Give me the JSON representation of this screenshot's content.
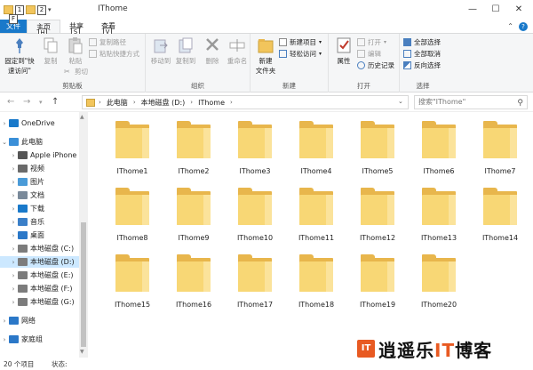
{
  "window": {
    "title": "IThome"
  },
  "quick_access": {
    "keytips": [
      "1",
      "2"
    ]
  },
  "tabs": [
    {
      "label": "文件",
      "keytip": "F"
    },
    {
      "label": "主页",
      "keytip": "H"
    },
    {
      "label": "共享",
      "keytip": "S"
    },
    {
      "label": "查看",
      "keytip": "V"
    }
  ],
  "ribbon": {
    "clipboard": {
      "group": "剪贴板",
      "pin_l1": "固定到\"快",
      "pin_l2": "速访问\"",
      "copy": "复制",
      "paste": "粘贴",
      "copy_path": "复制路径",
      "paste_shortcut": "粘贴快捷方式",
      "cut": "剪切"
    },
    "organize": {
      "group": "组织",
      "move_to": "移动到",
      "copy_to": "复制到",
      "delete": "删除",
      "rename": "重命名"
    },
    "new": {
      "group": "新建",
      "new_folder_l1": "新建",
      "new_folder_l2": "文件夹",
      "new_item": "新建项目",
      "easy_access": "轻松访问"
    },
    "open": {
      "group": "打开",
      "properties": "属性",
      "open": "打开",
      "edit": "编辑",
      "history": "历史记录"
    },
    "select": {
      "group": "选择",
      "select_all": "全部选择",
      "select_none": "全部取消",
      "invert": "反向选择"
    }
  },
  "address": {
    "crumbs": [
      "此电脑",
      "本地磁盘 (D:)",
      "IThome"
    ],
    "search_placeholder": "搜索\"IThome\""
  },
  "nav": {
    "items": [
      {
        "label": "OneDrive",
        "icon": "onedrive-icon"
      },
      {
        "label": "此电脑",
        "icon": "pc-icon"
      },
      {
        "label": "Apple iPhone",
        "icon": "phone-icon"
      },
      {
        "label": "视频",
        "icon": "video-icon"
      },
      {
        "label": "图片",
        "icon": "picture-icon"
      },
      {
        "label": "文档",
        "icon": "document-icon"
      },
      {
        "label": "下载",
        "icon": "download-icon"
      },
      {
        "label": "音乐",
        "icon": "music-icon"
      },
      {
        "label": "桌面",
        "icon": "desktop-icon"
      },
      {
        "label": "本地磁盘 (C:)",
        "icon": "drive-icon"
      },
      {
        "label": "本地磁盘 (D:)",
        "icon": "drive-icon"
      },
      {
        "label": "本地磁盘 (E:)",
        "icon": "drive-icon"
      },
      {
        "label": "本地磁盘 (F:)",
        "icon": "drive-icon"
      },
      {
        "label": "本地磁盘 (G:)",
        "icon": "drive-icon"
      },
      {
        "label": "网络",
        "icon": "network-icon"
      },
      {
        "label": "家庭组",
        "icon": "homegroup-icon"
      }
    ]
  },
  "folders": [
    "IThome1",
    "IThome2",
    "IThome3",
    "IThome4",
    "IThome5",
    "IThome6",
    "IThome7",
    "IThome8",
    "IThome9",
    "IThome10",
    "IThome11",
    "IThome12",
    "IThome13",
    "IThome14",
    "IThome15",
    "IThome16",
    "IThome17",
    "IThome18",
    "IThome19",
    "IThome20"
  ],
  "status": {
    "count": "20 个项目",
    "state": "状态:"
  },
  "watermark": {
    "logo": "IT",
    "text_a": "逍遥乐",
    "text_b": "IT",
    "text_c": "博客"
  },
  "colors": {
    "accent": "#1979ca",
    "folder": "#f8d775",
    "selection": "#cce8ff",
    "brand": "#e85a22"
  }
}
